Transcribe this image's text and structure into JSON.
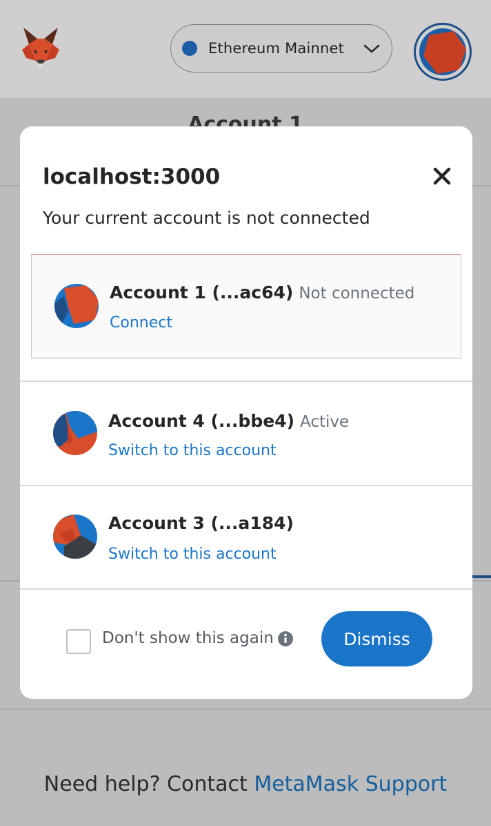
{
  "header": {
    "network": {
      "label": "Ethereum Mainnet",
      "dot_color": "#1c5ea5"
    },
    "logo_icon": "metamask-fox-icon",
    "account_avatar_icon": "jazzicon-avatar"
  },
  "background": {
    "account_title": "Account 1",
    "help_prefix": "Need help? Contact",
    "help_link": "MetaMask Support"
  },
  "modal": {
    "title": "localhost:3000",
    "subtitle": "Your current account is not connected",
    "accounts": [
      {
        "name": "Account 1 (...ac64)",
        "status": "Not connected",
        "action": "Connect"
      },
      {
        "name": "Account 4 (...bbe4)",
        "status": "Active",
        "action": "Switch to this account"
      },
      {
        "name": "Account 3 (...a184)",
        "status": "",
        "action": "Switch to this account"
      }
    ],
    "checkbox_label": "Don't show this again",
    "checkbox_checked": false,
    "dismiss_label": "Dismiss"
  },
  "colors": {
    "accent": "#1a75c9",
    "text": "#24272a",
    "muted": "#6a737d",
    "overlay": "#bcbcbc"
  }
}
